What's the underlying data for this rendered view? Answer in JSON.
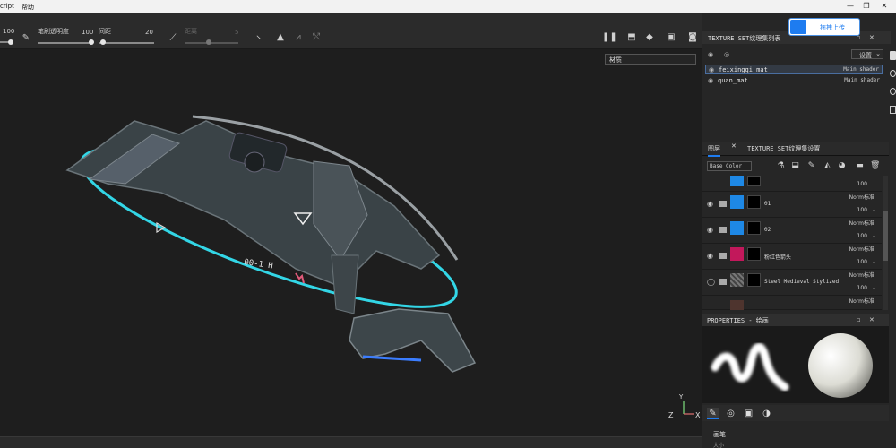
{
  "menubar": {
    "items": [
      "cript",
      "帮助"
    ]
  },
  "window_controls": [
    "—",
    "❐",
    "✕"
  ],
  "upload": {
    "label": "拖拽上传"
  },
  "toolbar": {
    "size_value": "100",
    "opacity_label": "笔刷透明度",
    "opacity_value": "100",
    "spacing_label": "间距",
    "spacing_value": "20",
    "distance_label": "距离",
    "distance_value": "5"
  },
  "viewport": {
    "material_dropdown": "材质",
    "axis": {
      "z": "Z",
      "x": "X",
      "y": "Y"
    }
  },
  "shader_panel": {
    "title": "TEXTURE SET纹理集列表",
    "settings_label": "设置",
    "shaders": [
      {
        "name": "feixingqi_mat",
        "shader": "Main shader",
        "selected": true
      },
      {
        "name": "quan_mat",
        "shader": "Main shader",
        "selected": false
      }
    ]
  },
  "layers_panel": {
    "tabs": [
      "图层",
      "TEXTURE SET纹理集设置"
    ],
    "channel": "Base Color",
    "layers": [
      {
        "name": "",
        "blend": "",
        "opacity": "100",
        "color": "#1e88e5",
        "partial": true
      },
      {
        "name": "01",
        "blend": "Norm标准",
        "opacity": "100",
        "color": "#1e88e5"
      },
      {
        "name": "02",
        "blend": "Norm标准",
        "opacity": "100",
        "color": "#1e88e5"
      },
      {
        "name": "粉红色箭头",
        "blend": "Norm标准",
        "opacity": "100",
        "color": "#c2185b"
      },
      {
        "name": "Steel Medieval Stylized",
        "blend": "Norm标准",
        "opacity": "100",
        "color": "#6d6d6d"
      },
      {
        "name": "",
        "blend": "Norm标准",
        "opacity": "",
        "color": "#4e342e",
        "partial": true
      }
    ]
  },
  "properties": {
    "title": "PROPERTIES - 绘画",
    "section": "画笔",
    "subsection": "大小"
  },
  "colors": {
    "accent": "#1e7cf0",
    "ring": "#33d6e6"
  }
}
